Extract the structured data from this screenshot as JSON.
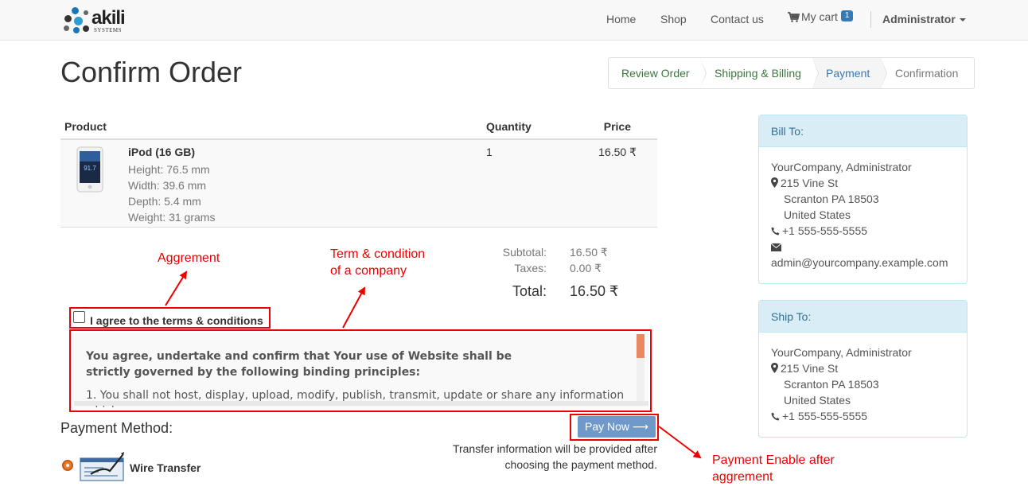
{
  "brand": {
    "name": "akili",
    "sub": "SYSTEMS"
  },
  "nav": {
    "home": "Home",
    "shop": "Shop",
    "contact": "Contact us",
    "cart": "My cart",
    "cart_count": "1",
    "user": "Administrator"
  },
  "page": {
    "title": "Confirm Order"
  },
  "wizard": {
    "steps": [
      "Review Order",
      "Shipping & Billing",
      "Payment",
      "Confirmation"
    ]
  },
  "table": {
    "headers": {
      "product": "Product",
      "quantity": "Quantity",
      "price": "Price"
    },
    "item": {
      "name": "iPod (16 GB)",
      "attrs": [
        "Height: 76.5 mm",
        "Width: 39.6 mm",
        "Depth: 5.4 mm",
        "Weight: 31 grams"
      ],
      "quantity": "1",
      "price": "16.50 ₹",
      "screen_text": "91.7"
    }
  },
  "totals": {
    "subtotal_label": "Subtotal:",
    "subtotal": "16.50 ₹",
    "taxes_label": "Taxes:",
    "taxes": "0.00 ₹",
    "total_label": "Total:",
    "total": "16.50 ₹"
  },
  "agreement": {
    "label": "I agree to the terms & conditions",
    "terms_heading_1": "You agree, undertake and confirm that Your use of Website shall be",
    "terms_heading_2": "strictly governed by the following binding principles:",
    "terms_item_1": "1. You shall not host, display, upload, modify, publish, transmit, update or share any information",
    "terms_item_1_cut": "which"
  },
  "payment": {
    "title": "Payment Method:",
    "option": "Wire Transfer",
    "pay_button": "Pay Now ⟶",
    "note_1": "Transfer information will be provided after",
    "note_2": "choosing the payment method."
  },
  "annotations": {
    "agreement": "Aggrement",
    "terms_1": "Term & condition",
    "terms_2": "of a company",
    "payment_1": "Payment Enable after",
    "payment_2": "aggrement"
  },
  "bill_to": {
    "title": "Bill To:",
    "name": "YourCompany, Administrator",
    "street": "215 Vine St",
    "city": "Scranton PA 18503",
    "country": "United States",
    "phone": "+1 555-555-5555",
    "email": "admin@yourcompany.example.com"
  },
  "ship_to": {
    "title": "Ship To:",
    "name": "YourCompany, Administrator",
    "street": "215 Vine St",
    "city": "Scranton PA 18503",
    "country": "United States",
    "phone": "+1 555-555-5555"
  },
  "colors": {
    "accent": "#337ab7",
    "success": "#3c763d",
    "annotation": "#ee0000",
    "panel_head": "#d9edf7",
    "pay_button": "#6e99c9"
  }
}
